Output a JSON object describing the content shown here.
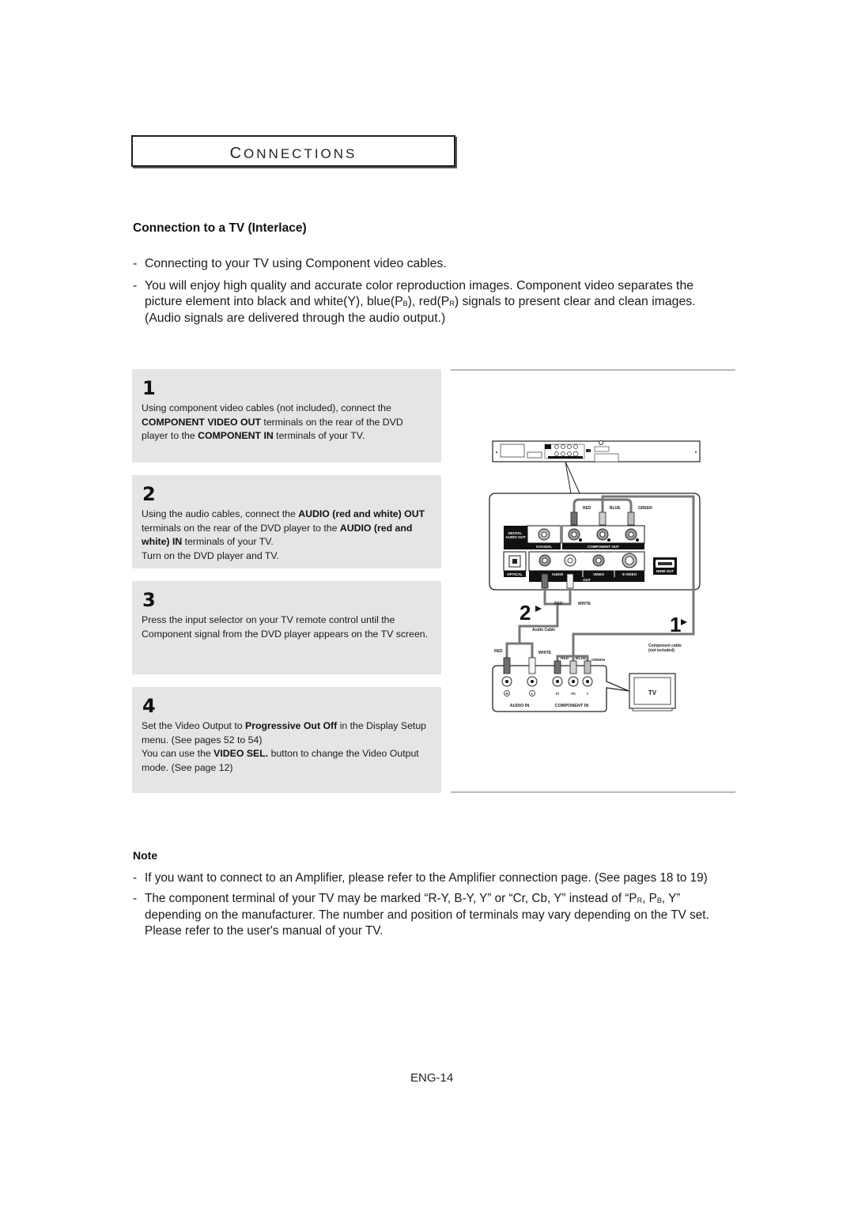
{
  "section": {
    "title_first": "C",
    "title_rest": "ONNECTIONS"
  },
  "heading": "Connection to a TV (Interlace)",
  "intro_bullets": [
    {
      "text": "Connecting to your TV using Component video cables."
    },
    {
      "part1": "You will enjoy high quality and accurate color reproduction images. Component video separates the picture element into black and white(Y), blue(P",
      "sub1": "B",
      "part2": "), red(P",
      "sub2": "R",
      "part3": ") signals to present clear and clean images. (Audio signals are delivered through the audio output.)"
    }
  ],
  "steps": [
    {
      "number": "1",
      "segments": [
        {
          "t": "Using component video cables (not included), connect the ",
          "b": false
        },
        {
          "t": "COMPONENT VIDEO OUT",
          "b": true
        },
        {
          "t": " terminals on the rear of the DVD player to the ",
          "b": false
        },
        {
          "t": "COMPONENT IN",
          "b": true
        },
        {
          "t": " terminals of your TV.",
          "b": false
        }
      ]
    },
    {
      "number": "2",
      "segments": [
        {
          "t": "Using the audio cables, connect the ",
          "b": false
        },
        {
          "t": "AUDIO (red and white) OUT",
          "b": true
        },
        {
          "t": " terminals on the rear of the DVD player to the ",
          "b": false
        },
        {
          "t": "AUDIO (red and white) IN",
          "b": true
        },
        {
          "t": " terminals of your TV.",
          "b": false
        }
      ],
      "extra": "Turn on the DVD player and TV."
    },
    {
      "number": "3",
      "segments": [
        {
          "t": "Press the input selector on your TV remote control until the Component signal from the DVD player appears on the TV screen.",
          "b": false
        }
      ]
    },
    {
      "number": "4",
      "segments": [
        {
          "t": "Set the Video Output to ",
          "b": false
        },
        {
          "t": "Progressive Out Off",
          "b": true
        },
        {
          "t": " in the Display Setup menu. (See pages 52 to 54)",
          "b": false
        }
      ],
      "segments2": [
        {
          "t": "You can use the ",
          "b": false
        },
        {
          "t": "VIDEO SEL.",
          "b": true
        },
        {
          "t": " button to change the Video Output mode. (See page 12)",
          "b": false
        }
      ]
    }
  ],
  "diagram": {
    "labels": {
      "red": "RED",
      "blue": "BLUE",
      "green": "GREEN",
      "white": "WHITE",
      "digital_audio_out": [
        "DIGITAL",
        "AUDIO OUT"
      ],
      "coaxial": "COAXIAL",
      "component_out": "COMPONENT OUT",
      "optical": "OPTICAL",
      "audio": "AUDIO",
      "out": "OUT",
      "video": "VIDEO",
      "s_video": "S-VIDEO",
      "hdmi_out": "HDMI OUT",
      "audio_cable": "Audio Cable",
      "component_cable": [
        "Component cable",
        "(not included)"
      ],
      "step_markers": [
        "2",
        "1"
      ],
      "audio_in": "AUDIO IN",
      "component_in": "COMPONENT IN",
      "jack_r": "R",
      "jack_l": "L",
      "pr": "Pr",
      "pb": "Pb",
      "y": "Y",
      "tv": "TV"
    },
    "colors": {
      "red_plug": "#6e6e6e",
      "blue_plug": "#cfcfcf",
      "green_plug": "#bcbcbc",
      "white_plug": "#f6f6f6",
      "cable": "#777777"
    }
  },
  "note": {
    "title": "Note",
    "bullets": [
      {
        "text": "If you want to connect to an Amplifier, please refer to the Amplifier connection page. (See pages 18 to 19)"
      },
      {
        "part1": "The component terminal of your TV may be marked “R-Y, B-Y, Y” or “Cr, Cb, Y” instead of “P",
        "sub1": "R",
        "part2": ", P",
        "sub2": "B",
        "part3": ", Y” depending on the manufacturer. The number and position of terminals may vary depending on the TV set. Please refer to the user's manual of your TV."
      }
    ]
  },
  "page_number": "ENG-14"
}
